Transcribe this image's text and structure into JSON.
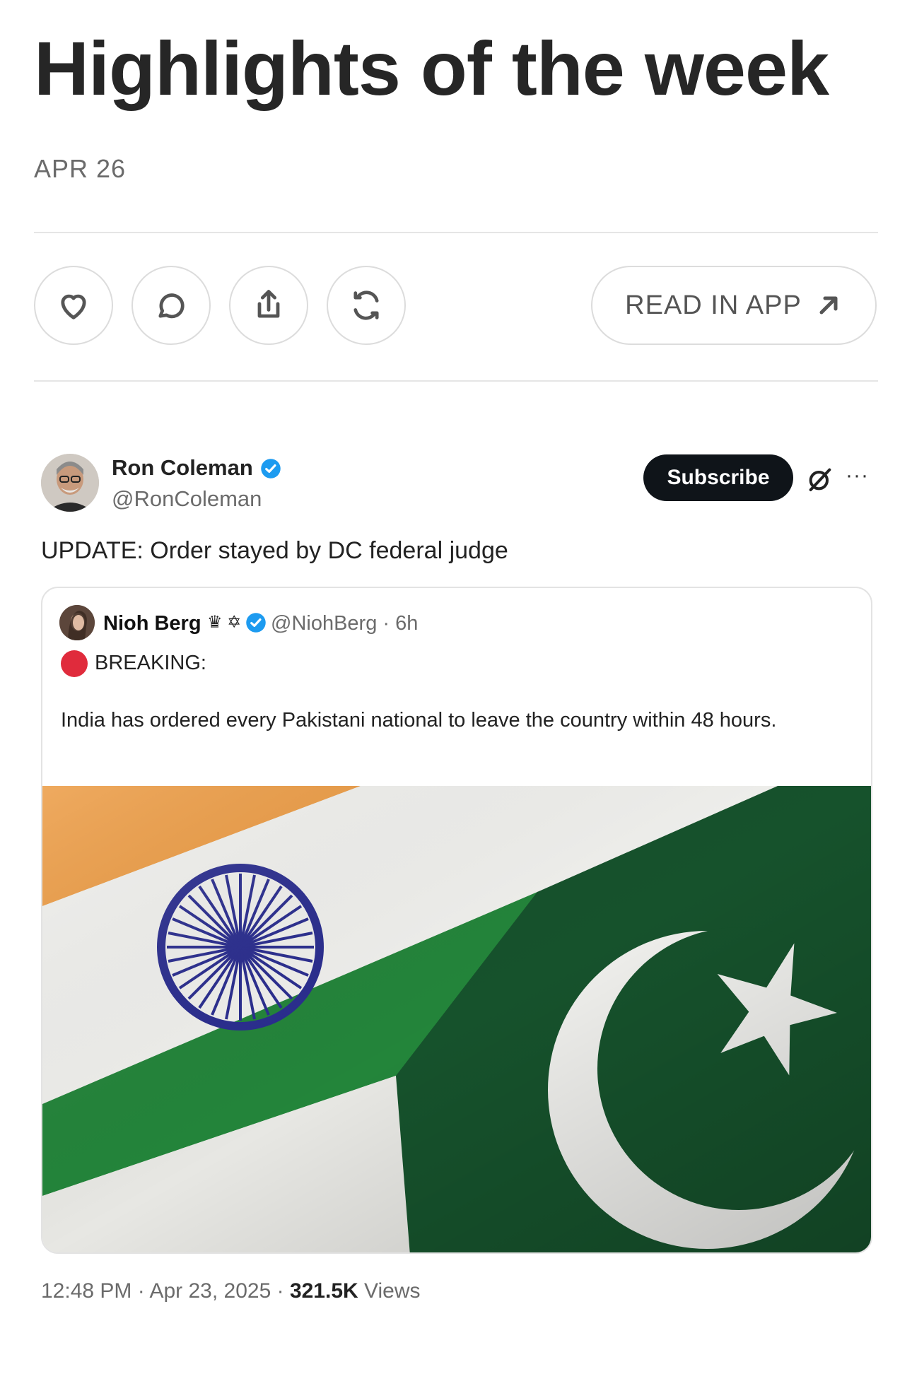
{
  "post": {
    "title": "Highlights of the week",
    "date": "APR 26"
  },
  "actions": {
    "like_icon": "heart-icon",
    "comment_icon": "comment-icon",
    "share_icon": "share-icon",
    "restack_icon": "restack-icon",
    "read_in_app_label": "READ IN APP",
    "read_in_app_icon": "arrow-up-right-icon"
  },
  "tweet": {
    "author_name": "Ron Coleman",
    "author_handle": "@RonColeman",
    "subscribe_label": "Subscribe",
    "more_label": "···",
    "text": "UPDATE: Order stayed by DC federal judge",
    "time": "12:48 PM",
    "date": "Apr 23, 2025",
    "views_count": "321.5K",
    "views_label": "Views",
    "separator": "·"
  },
  "quote": {
    "author_name": "Nioh Berg",
    "author_badges": "♛ ✡",
    "author_handle": "@NiohBerg · 6h",
    "breaking_label": "BREAKING:",
    "body": "India has ordered every Pakistani national to leave the country within 48 hours."
  },
  "colors": {
    "verified_blue": "#1d9bf0",
    "subscribe_bg": "#0f1419",
    "breaking_red": "#e02b3c",
    "india_saffron": "#f0953a",
    "india_green": "#1f7a2e",
    "chakra_blue": "#2a2d8f",
    "pakistan_green": "#15512b"
  }
}
